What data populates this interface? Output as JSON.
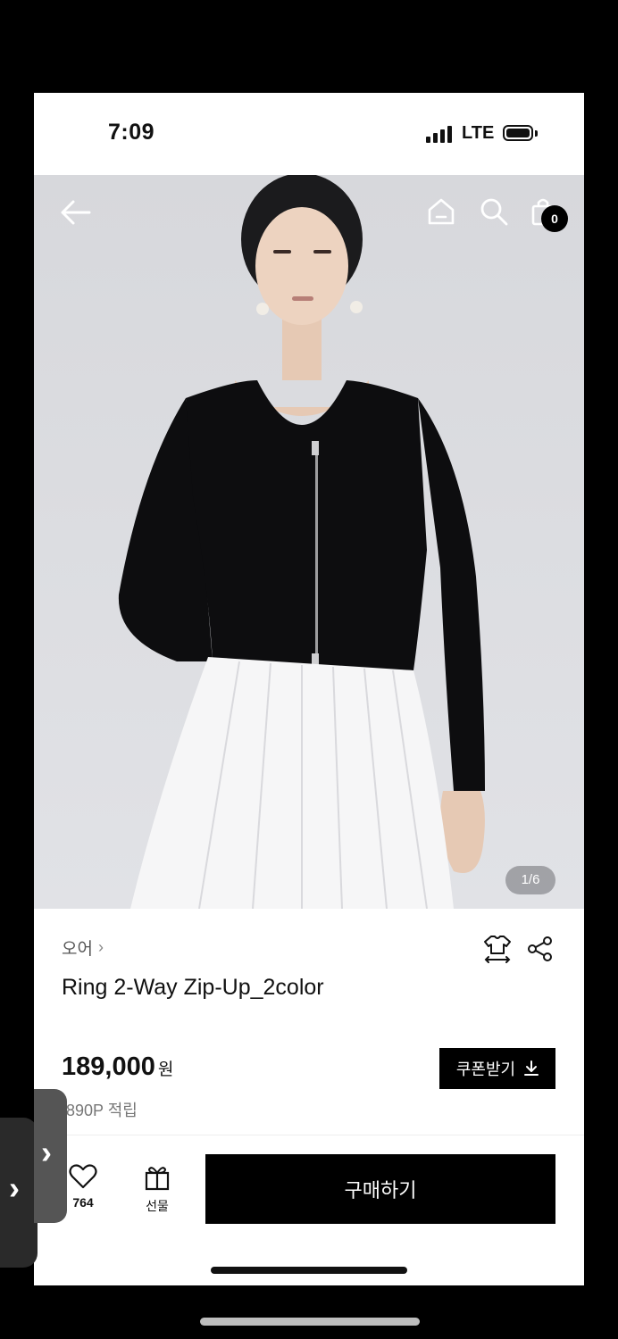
{
  "status_bar": {
    "time": "7:09",
    "network": "LTE"
  },
  "header": {
    "cart_count": "0"
  },
  "gallery": {
    "pager": "1/6"
  },
  "product": {
    "category": "오어",
    "title": "Ring 2-Way Zip-Up_2color",
    "price": "189,000",
    "price_unit": "원",
    "points": ",890P 적립"
  },
  "coupon": {
    "label": "쿠폰받기"
  },
  "actions": {
    "like_count": "764",
    "gift_label": "선물",
    "buy_label": "구매하기"
  },
  "icons": [
    "back-arrow-icon",
    "home-icon",
    "search-icon",
    "cart-icon",
    "size-guide-icon",
    "share-icon",
    "download-icon",
    "heart-icon",
    "gift-icon",
    "chevron-right-icon"
  ],
  "colors": {
    "accent": "#000000",
    "background": "#ffffff"
  }
}
